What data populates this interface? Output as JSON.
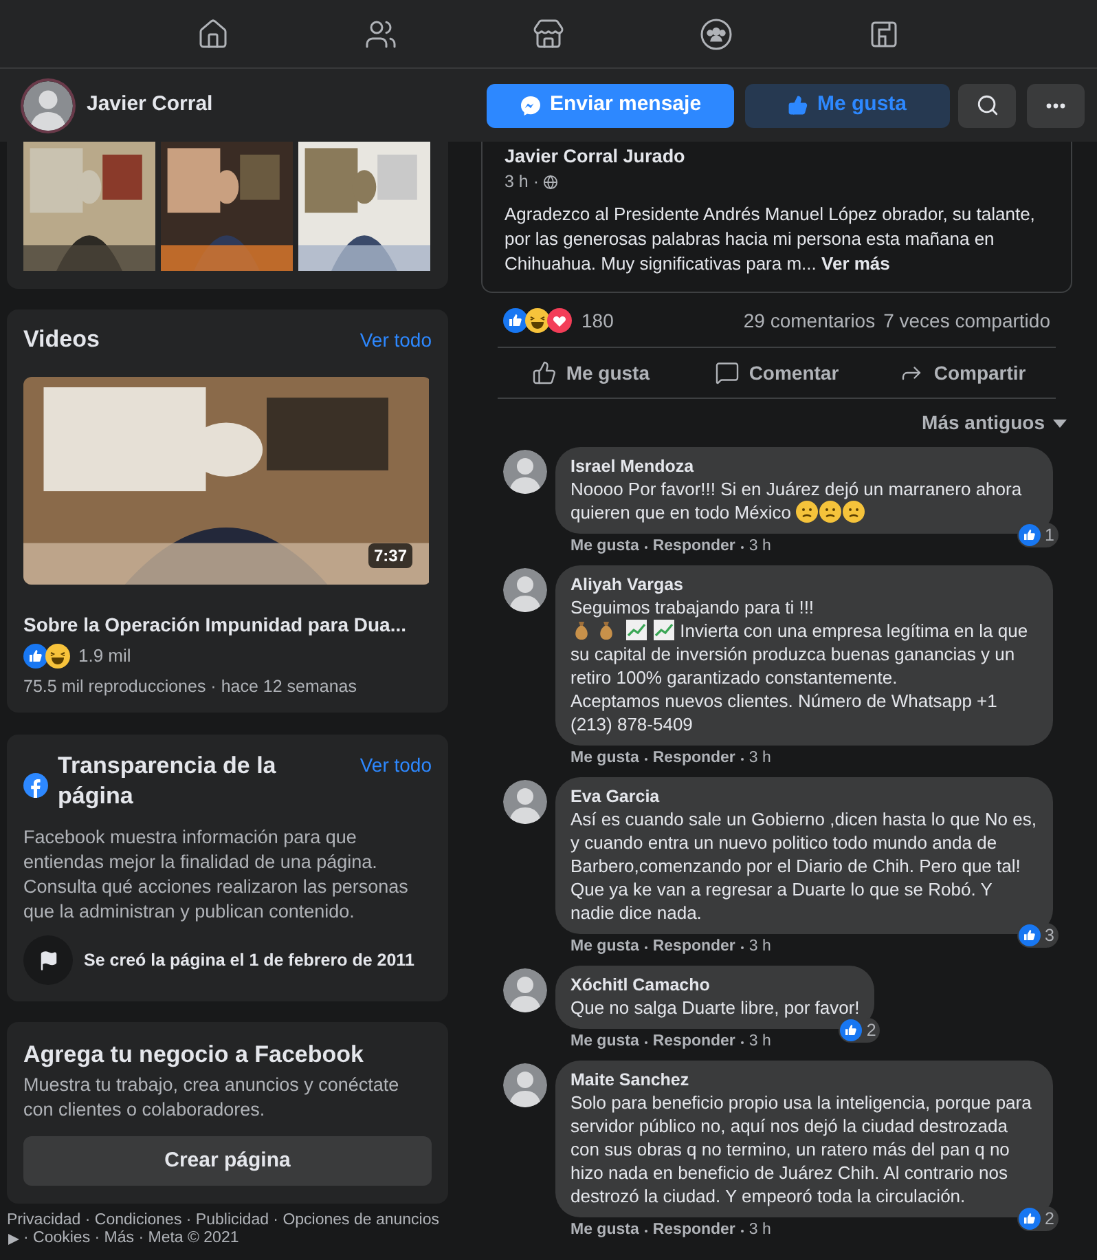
{
  "header": {
    "page_name": "Javier Corral",
    "buttons": [
      {
        "label": "Enviar mensaje",
        "kind": "message"
      },
      {
        "label": "Me gusta",
        "kind": "like"
      }
    ]
  },
  "videos": {
    "title": "Videos",
    "link": "Ver todo",
    "duration": "7:37",
    "video_title": "Sobre la Operación Impunidad para Dua...",
    "reactions": "1.9 mil",
    "meta": "75.5 mil reproducciones · hace 12 semanas"
  },
  "transparency": {
    "title": "Transparencia de la página",
    "link": "Ver todo",
    "description": "Facebook muestra información para que entiendas mejor la finalidad de una página. Consulta qué acciones realizaron las personas que la administran y publican contenido.",
    "created": "Se creó la página el 1 de febrero de 2011"
  },
  "business": {
    "title": "Agrega tu negocio a Facebook",
    "description": "Muestra tu trabajo, crea anuncios y conéctate con clientes o colaboradores.",
    "button": "Crear página"
  },
  "footer": [
    "Privacidad · Condiciones · Publicidad · Opciones de anuncios",
    "· Cookies · Más · Meta © 2021"
  ],
  "post": {
    "author": "Javier Corral Jurado",
    "time": "3 h ·",
    "text": "Agradezco al Presidente Andrés Manuel López obrador, su talante, por las generosas palabras hacia mi persona esta mañana en Chihuahua. Muy significativas para m...",
    "more": "Ver más",
    "reaction_count": "180",
    "comments": "29 comentarios",
    "shares": "7 veces compartido",
    "actions": [
      {
        "label": "Me gusta",
        "kind": "like"
      },
      {
        "label": "Comentar",
        "kind": "comment"
      },
      {
        "label": "Compartir",
        "kind": "share"
      }
    ],
    "sort": "Más antiguos"
  },
  "comments": [
    {
      "author": "Israel Mendoza",
      "lines": [
        {
          "text": "Noooo Por favor!!! Si en Juárez dejó un marranero ahora quieren que en todo México",
          "emoji_after": [
            {
              "kind": "face"
            },
            {
              "kind": "face"
            },
            {
              "kind": "face"
            }
          ]
        }
      ],
      "likes": "1",
      "actions": [
        "Me gusta",
        "Responder",
        "3 h"
      ]
    },
    {
      "author": "Aliyah Vargas",
      "lines": [
        {
          "text": "Seguimos trabajando para ti !!!"
        },
        {
          "emoji_before": [
            {
              "kind": "bag"
            },
            {
              "kind": "bag"
            },
            {
              "kind": "chart"
            },
            {
              "kind": "chart"
            }
          ],
          "text": "Invierta con una empresa legítima en la que su capital de inversión produzca buenas ganancias y un retiro 100% garantizado constantemente."
        },
        {
          "text": "Aceptamos nuevos clientes. Número de Whatsapp +1 (213) 878-5409"
        }
      ],
      "actions": [
        "Me gusta",
        "Responder",
        "3 h"
      ]
    },
    {
      "author": "Eva Garcia",
      "lines": [
        {
          "text": "Así es cuando sale un Gobierno ,dicen hasta lo que No es, y cuando entra un nuevo politico todo mundo anda de Barbero,comenzando por el Diario de Chih. Pero que tal! Que ya ke van a regresar a Duarte lo que se Robó. Y nadie dice nada."
        }
      ],
      "likes": "3",
      "actions": [
        "Me gusta",
        "Responder",
        "3 h"
      ]
    },
    {
      "author": "Xóchitl Camacho",
      "lines": [
        {
          "text": "Que no salga Duarte libre, por favor!"
        }
      ],
      "likes": "2",
      "actions": [
        "Me gusta",
        "Responder",
        "3 h"
      ]
    },
    {
      "author": "Maite Sanchez",
      "lines": [
        {
          "text": "Solo para beneficio propio usa la inteligencia, porque para servidor público no, aquí nos dejó la ciudad destrozada con sus obras q no termino, un ratero más del pan q no hizo nada en beneficio de Juárez Chih. Al contrario nos destrozó la ciudad. Y empeoró toda la circulación."
        }
      ],
      "likes": "2",
      "actions": [
        "Me gusta",
        "Responder",
        "3 h"
      ]
    }
  ]
}
